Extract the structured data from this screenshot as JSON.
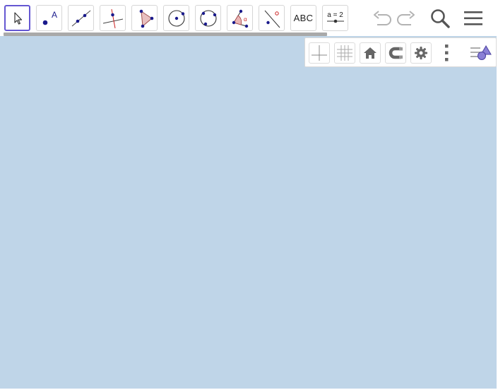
{
  "toolbar": {
    "tools": [
      {
        "name": "move-tool",
        "icon": "cursor-arrow-icon"
      },
      {
        "name": "point-tool",
        "icon": "point-icon",
        "label": "A"
      },
      {
        "name": "line-tool",
        "icon": "line-icon"
      },
      {
        "name": "perpendicular-line-tool",
        "icon": "perpendicular-icon"
      },
      {
        "name": "polygon-tool",
        "icon": "polygon-icon"
      },
      {
        "name": "circle-center-point-tool",
        "icon": "circle-center-icon"
      },
      {
        "name": "circle-three-points-tool",
        "icon": "circle-three-points-icon"
      },
      {
        "name": "angle-tool",
        "icon": "angle-icon",
        "label": "α"
      },
      {
        "name": "reflect-about-line-tool",
        "icon": "reflect-icon"
      },
      {
        "name": "text-tool",
        "label": "ABC"
      },
      {
        "name": "slider-tool",
        "label": "a = 2"
      }
    ],
    "actions": [
      "undo-icon",
      "redo-icon",
      "search-icon",
      "menu-icon"
    ]
  },
  "style_bar": {
    "buttons": [
      "axes-toggle-icon",
      "grid-toggle-icon",
      "home-view-icon",
      "snap-magnet-icon",
      "settings-gear-icon",
      "more-options-icon",
      "toggle-style-bar-icon"
    ]
  },
  "colors": {
    "canvas": "#bfd5e8",
    "accent": "#6557d2",
    "point": "#1a1a8c"
  }
}
